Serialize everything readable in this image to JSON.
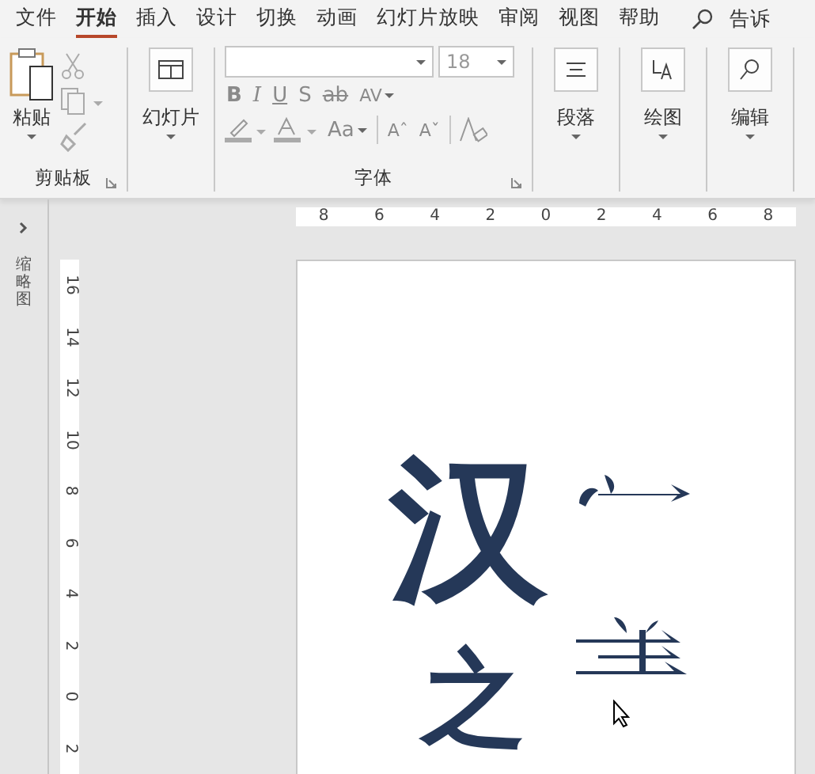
{
  "tabs": [
    {
      "label": "文件",
      "selected": false
    },
    {
      "label": "开始",
      "selected": true
    },
    {
      "label": "插入",
      "selected": false
    },
    {
      "label": "设计",
      "selected": false
    },
    {
      "label": "切换",
      "selected": false
    },
    {
      "label": "动画",
      "selected": false
    },
    {
      "label": "幻灯片放映",
      "selected": false
    },
    {
      "label": "审阅",
      "selected": false
    },
    {
      "label": "视图",
      "selected": false
    },
    {
      "label": "帮助",
      "selected": false
    }
  ],
  "tell_me": "告诉",
  "clipboard": {
    "paste": "粘贴",
    "label": "剪贴板"
  },
  "slides": {
    "label": "幻灯片"
  },
  "font": {
    "font_size": "18",
    "label": "字体",
    "format_buttons": [
      "B",
      "I",
      "U",
      "S",
      "ab"
    ],
    "spacing": "AV",
    "case": "Aa",
    "grow": "Aˆ",
    "shrink": "Aˇ"
  },
  "paragraph": {
    "label": "段落"
  },
  "drawing": {
    "label": "绘图"
  },
  "editing": {
    "label": "编辑"
  },
  "thumbnail_pane": {
    "label": "缩略图"
  },
  "h_ruler": [
    "8",
    "6",
    "4",
    "2",
    "0",
    "2",
    "4",
    "6",
    "8"
  ],
  "v_ruler": [
    "16",
    "14",
    "12",
    "10",
    "8",
    "6",
    "4",
    "2",
    "0",
    "2"
  ],
  "slide": {
    "characters": [
      "汉",
      "之"
    ]
  }
}
